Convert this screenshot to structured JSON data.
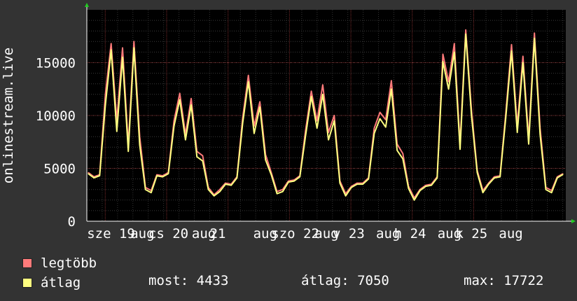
{
  "chart_data": {
    "type": "line",
    "ylabel": "onlinestream.live",
    "ylim": [
      0,
      20000
    ],
    "yticks": [
      0,
      5000,
      10000,
      15000
    ],
    "ytick_labels": [
      "0",
      "5000",
      "10000",
      "15000"
    ],
    "grid": true,
    "background": "#000000",
    "xtick_labels": [
      "sze 19 aug",
      "cs 20 aug",
      "p 21 aug",
      "szo 22 aug",
      "v 23 aug",
      "h 24 aug",
      "k 25 aug"
    ],
    "xtick_texts_rendered": [
      "sze 19",
      "aug",
      "cs 20",
      "aug",
      "21",
      "aug",
      "szo 22",
      "aug",
      "v 23",
      "aug",
      "h 24",
      "aug",
      "k 25",
      "aug"
    ],
    "days": [
      "sze 19",
      "cs 20",
      "p 21",
      "szo 22",
      "v 23",
      "h 24",
      "k 25"
    ],
    "series": [
      {
        "name": "legtöbb",
        "color": "#ff7a7a",
        "values": [
          4600,
          4200,
          4400,
          12000,
          16800,
          9500,
          16400,
          7200,
          17000,
          8000,
          3200,
          2900,
          4400,
          4300,
          4600,
          9500,
          12100,
          8200,
          11600,
          6600,
          6200,
          3200,
          2500,
          3000,
          3600,
          3500,
          4200,
          9800,
          13800,
          9000,
          11300,
          6300,
          4600,
          2800,
          3000,
          3800,
          3900,
          4300,
          8600,
          12300,
          9500,
          12900,
          8400,
          10000,
          3800,
          2600,
          3300,
          3600,
          3600,
          4100,
          8800,
          10300,
          9600,
          13300,
          7300,
          6400,
          3300,
          2200,
          3000,
          3400,
          3500,
          4200,
          15800,
          13200,
          16800,
          7300,
          18100,
          10500,
          4800,
          2900,
          3600,
          4200,
          4300,
          10200,
          16700,
          9000,
          15600,
          7800,
          17800,
          8800,
          3200,
          2900,
          4200,
          4500
        ]
      },
      {
        "name": "átlag",
        "color": "#ffff80",
        "values": [
          4500,
          4100,
          4300,
          11000,
          16200,
          8500,
          15500,
          6600,
          16400,
          7200,
          3000,
          2700,
          4300,
          4200,
          4500,
          9000,
          11500,
          7700,
          11000,
          6100,
          5700,
          3000,
          2400,
          2800,
          3500,
          3400,
          4100,
          9300,
          13200,
          8300,
          10800,
          5800,
          4400,
          2600,
          2800,
          3700,
          3800,
          4200,
          8100,
          11800,
          8800,
          12000,
          7700,
          9500,
          3600,
          2400,
          3200,
          3500,
          3500,
          4000,
          8300,
          9700,
          8900,
          12500,
          6700,
          5900,
          3100,
          2000,
          2900,
          3300,
          3400,
          4100,
          15100,
          12500,
          16000,
          6800,
          17700,
          10000,
          4600,
          2700,
          3500,
          4100,
          4200,
          9800,
          16100,
          8400,
          15000,
          7300,
          17300,
          8200,
          3000,
          2700,
          4100,
          4433
        ]
      }
    ]
  },
  "legend": {
    "items": [
      {
        "label": "legtöbb",
        "color": "#ff7a7a"
      },
      {
        "label": "átlag",
        "color": "#ffff80"
      }
    ]
  },
  "stats": {
    "most": "most: 4433",
    "atlag": "átlag: 7050",
    "max": "max: 17722"
  }
}
